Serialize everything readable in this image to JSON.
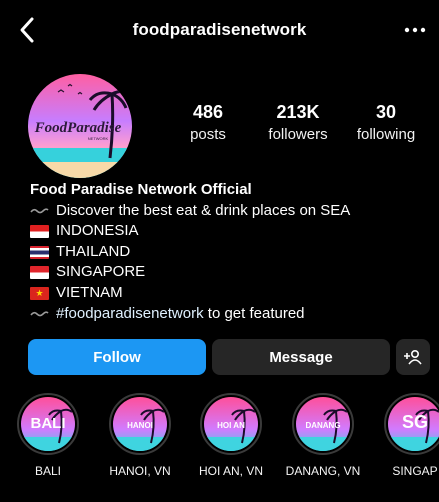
{
  "header": {
    "username": "foodparadisenetwork"
  },
  "avatar": {
    "logo_text": "FoodParadise",
    "logo_subtext": "NETWORK"
  },
  "stats": [
    {
      "value": "486",
      "label": "posts"
    },
    {
      "value": "213K",
      "label": "followers"
    },
    {
      "value": "30",
      "label": "following"
    }
  ],
  "bio": {
    "name": "Food Paradise Network Official",
    "lines": [
      {
        "icon": "wave-icon",
        "text": "Discover the best eat & drink places on SEA"
      },
      {
        "icon": "indonesia-flag-icon",
        "text": "INDONESIA"
      },
      {
        "icon": "thailand-flag-icon",
        "text": "THAILAND"
      },
      {
        "icon": "singapore-flag-icon",
        "text": "SINGAPORE"
      },
      {
        "icon": "vietnam-flag-icon",
        "text": "VIETNAM"
      },
      {
        "icon": "wave-icon",
        "hashtag": "#foodparadisenetwork",
        "text": "to get featured"
      }
    ]
  },
  "actions": {
    "follow": "Follow",
    "message": "Message",
    "add_user_icon": "add-user-icon"
  },
  "highlights": [
    {
      "cover": "BALI",
      "label": "BALI"
    },
    {
      "cover": "HANOI",
      "label": "HANOI, VN"
    },
    {
      "cover": "HOI AN",
      "label": "HOI AN, VN"
    },
    {
      "cover": "DANANG",
      "label": "DANANG, VN"
    },
    {
      "cover": "SG",
      "label": "SINGAP"
    }
  ],
  "colors": {
    "background": "#000000",
    "follow_button": "#1c97f3",
    "secondary_button": "#262626",
    "hashtag": "#e0f1ff"
  }
}
